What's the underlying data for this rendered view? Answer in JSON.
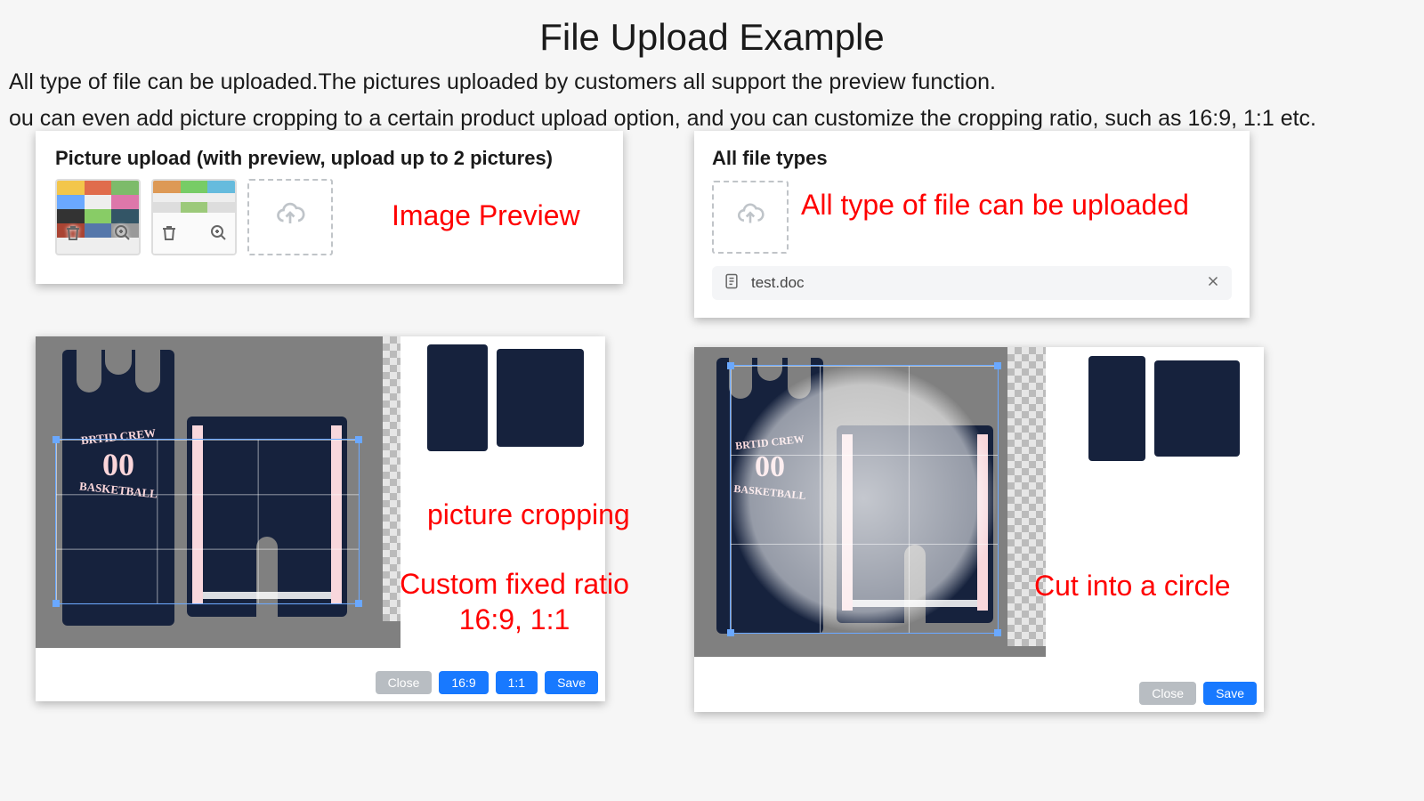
{
  "page_title": "File Upload Example",
  "desc_line1": "All type of file can be uploaded.The pictures uploaded by customers all support the preview function.",
  "desc_line2": "ou can even add picture cropping to a certain product upload option, and you can customize the cropping ratio, such as 16:9, 1:1 etc.",
  "cardA": {
    "label": "Picture upload (with preview, upload up to 2 pictures)"
  },
  "annotA": "Image Preview",
  "cardB": {
    "label": "All file types",
    "file_name": "test.doc"
  },
  "annotB": "All type of file can be uploaded",
  "cardC": {
    "btn_close": "Close",
    "btn_169": "16:9",
    "btn_11": "1:1",
    "btn_save": "Save"
  },
  "annotC1": "picture cropping",
  "annotC2a": "Custom fixed ratio",
  "annotC2b": "16:9, 1:1",
  "cardD": {
    "btn_close": "Close",
    "btn_save": "Save"
  },
  "annotD": "Cut into a circle",
  "jersey": {
    "line1": "BRTID CREW",
    "number": "00",
    "line2": "BASKETBALL"
  },
  "colors": {
    "accent_red": "#ff0000",
    "button_blue": "#1879ff",
    "button_gray": "#b8bdc2",
    "garment_navy": "#16223d"
  }
}
